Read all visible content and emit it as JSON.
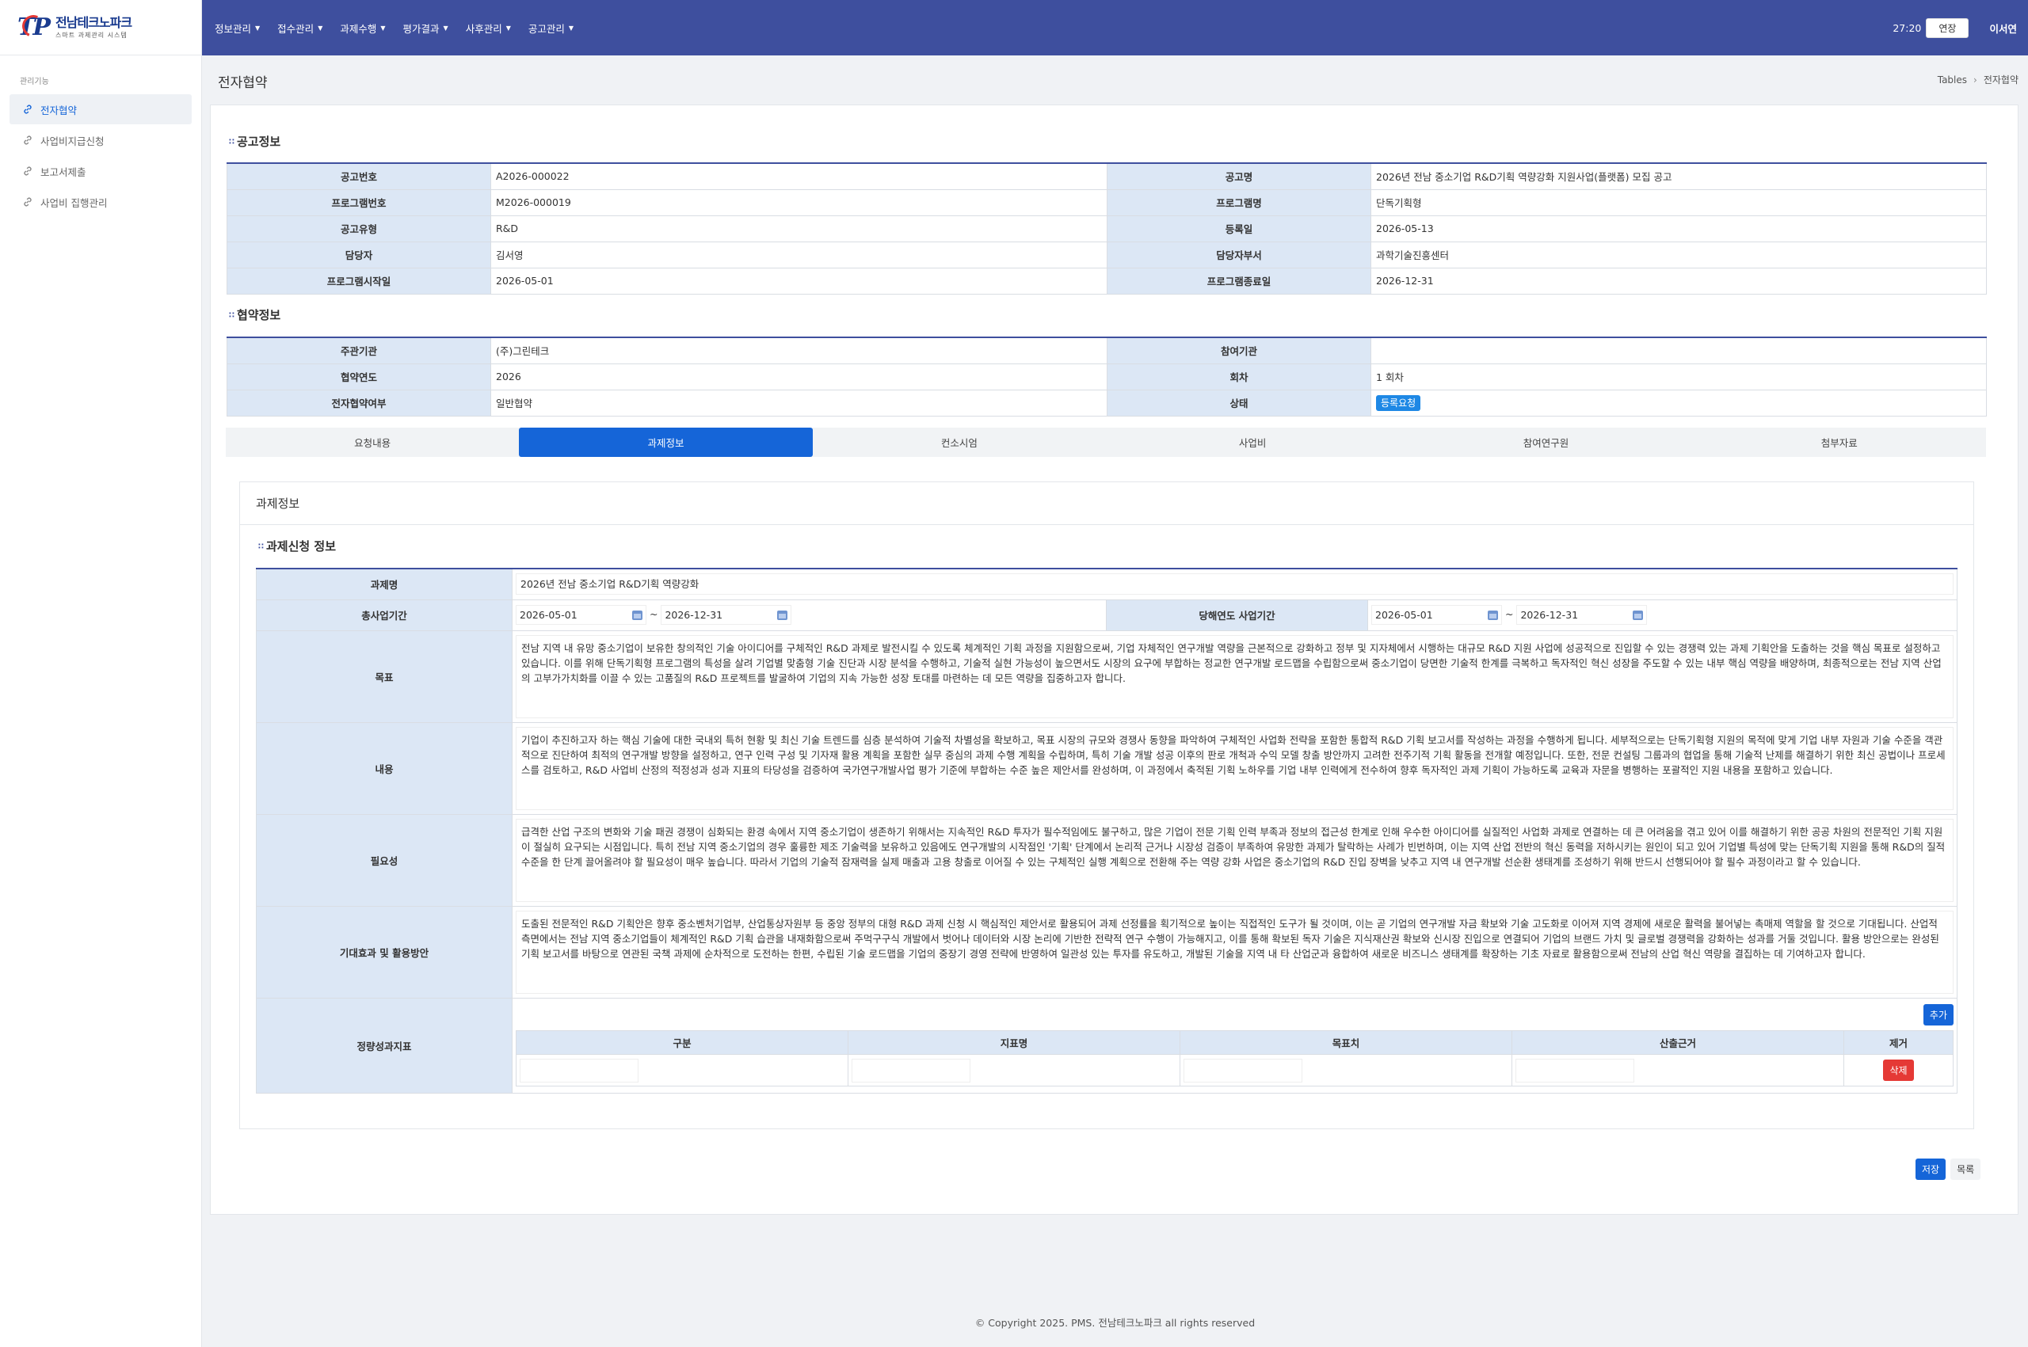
{
  "brand": {
    "name": "전남테크노파크",
    "subtitle": "스마트 과제관리 시스템",
    "mark": "TP"
  },
  "nav": [
    "정보관리",
    "접수관리",
    "과제수행",
    "평가결과",
    "사후관리",
    "공고관리"
  ],
  "header": {
    "timer": "27:20",
    "extend_label": "연장",
    "user": "이서연"
  },
  "sidebar": {
    "title": "관리기능",
    "items": [
      "전자협약",
      "사업비지급신청",
      "보고서제출",
      "사업비 집행관리"
    ]
  },
  "page": {
    "title": "전자협약",
    "breadcrumb": [
      "Tables",
      "전자협약"
    ]
  },
  "notice": {
    "title": "공고정보",
    "rows": [
      [
        "공고번호",
        "A2026-000022",
        "공고명",
        "2026년 전남 중소기업 R&D기획 역량강화 지원사업(플랫폼) 모집 공고"
      ],
      [
        "프로그램번호",
        "M2026-000019",
        "프로그램명",
        "단독기획형"
      ],
      [
        "공고유형",
        "R&D",
        "등록일",
        "2026-05-13"
      ],
      [
        "담당자",
        "김서영",
        "담당자부서",
        "과학기술진흥센터"
      ],
      [
        "프로그램시작일",
        "2026-05-01",
        "프로그램종료일",
        "2026-12-31"
      ]
    ]
  },
  "agreement": {
    "title": "협약정보",
    "rows": [
      [
        "주관기관",
        "(주)그린테크",
        "참여기관",
        ""
      ],
      [
        "협약연도",
        "2026",
        "회차",
        "1 회차"
      ],
      [
        "전자협약여부",
        "일반협약",
        "상태",
        "등록요청"
      ]
    ]
  },
  "tabs": [
    "요청내용",
    "과제정보",
    "컨소시엄",
    "사업비",
    "참여연구원",
    "첨부자료"
  ],
  "panel": {
    "heading": "과제정보",
    "section_title": "과제신청 정보"
  },
  "project": {
    "name_label": "과제명",
    "name": "2026년 전남 중소기업 R&D기획 역량강화",
    "period_label": "총사업기간",
    "period_start": "2026-05-01",
    "period_end": "2026-12-31",
    "year_label": "당해연도 사업기간",
    "year_start": "2026-05-01",
    "year_end": "2026-12-31",
    "tilde": "~",
    "goal_label": "목표",
    "goal": "전남 지역 내 유망 중소기업이 보유한 창의적인 기술 아이디어를 구체적인 R&D 과제로 발전시킬 수 있도록 체계적인 기획 과정을 지원함으로써, 기업 자체적인 연구개발 역량을 근본적으로 강화하고 정부 및 지자체에서 시행하는 대규모 R&D 지원 사업에 성공적으로 진입할 수 있는 경쟁력 있는 과제 기획안을 도출하는 것을 핵심 목표로 설정하고 있습니다. 이를 위해 단독기획형 프로그램의 특성을 살려 기업별 맞춤형 기술 진단과 시장 분석을 수행하고, 기술적 실현 가능성이 높으면서도 시장의 요구에 부합하는 정교한 연구개발 로드맵을 수립함으로써 중소기업이 당면한 기술적 한계를 극복하고 독자적인 혁신 성장을 주도할 수 있는 내부 핵심 역량을 배양하며, 최종적으로는 전남 지역 산업의 고부가가치화를 이끌 수 있는 고품질의 R&D 프로젝트를 발굴하여 기업의 지속 가능한 성장 토대를 마련하는 데 모든 역량을 집중하고자 합니다.",
    "content_label": "내용",
    "content": "기업이 추진하고자 하는 핵심 기술에 대한 국내외 특허 현황 및 최신 기술 트렌드를 심층 분석하여 기술적 차별성을 확보하고, 목표 시장의 규모와 경쟁사 동향을 파악하여 구체적인 사업화 전략을 포함한 통합적 R&D 기획 보고서를 작성하는 과정을 수행하게 됩니다. 세부적으로는 단독기획형 지원의 목적에 맞게 기업 내부 자원과 기술 수준을 객관적으로 진단하여 최적의 연구개발 방향을 설정하고, 연구 인력 구성 및 기자재 활용 계획을 포함한 실무 중심의 과제 수행 계획을 수립하며, 특히 기술 개발 성공 이후의 판로 개척과 수익 모델 창출 방안까지 고려한 전주기적 기획 활동을 전개할 예정입니다. 또한, 전문 컨설팅 그룹과의 협업을 통해 기술적 난제를 해결하기 위한 최신 공법이나 프로세스를 검토하고, R&D 사업비 산정의 적정성과 성과 지표의 타당성을 검증하여 국가연구개발사업 평가 기준에 부합하는 수준 높은 제안서를 완성하며, 이 과정에서 축적된 기획 노하우를 기업 내부 인력에게 전수하여 향후 독자적인 과제 기획이 가능하도록 교육과 자문을 병행하는 포괄적인 지원 내용을 포함하고 있습니다.",
    "need_label": "필요성",
    "need": "급격한 산업 구조의 변화와 기술 패권 경쟁이 심화되는 환경 속에서 지역 중소기업이 생존하기 위해서는 지속적인 R&D 투자가 필수적임에도 불구하고, 많은 기업이 전문 기획 인력 부족과 정보의 접근성 한계로 인해 우수한 아이디어를 실질적인 사업화 과제로 연결하는 데 큰 어려움을 겪고 있어 이를 해결하기 위한 공공 차원의 전문적인 기획 지원이 절실히 요구되는 시점입니다. 특히 전남 지역 중소기업의 경우 훌륭한 제조 기술력을 보유하고 있음에도 연구개발의 시작점인 '기획' 단계에서 논리적 근거나 시장성 검증이 부족하여 유망한 과제가 탈락하는 사례가 빈번하며, 이는 지역 산업 전반의 혁신 동력을 저하시키는 원인이 되고 있어 기업별 특성에 맞는 단독기획 지원을 통해 R&D의 질적 수준을 한 단계 끌어올려야 할 필요성이 매우 높습니다. 따라서 기업의 기술적 잠재력을 실제 매출과 고용 창출로 이어질 수 있는 구체적인 실행 계획으로 전환해 주는 역량 강화 사업은 중소기업의 R&D 진입 장벽을 낮추고 지역 내 연구개발 선순환 생태계를 조성하기 위해 반드시 선행되어야 할 필수 과정이라고 할 수 있습니다.",
    "effect_label": "기대효과 및 활용방안",
    "effect": "도출된 전문적인 R&D 기획안은 향후 중소벤처기업부, 산업통상자원부 등 중앙 정부의 대형 R&D 과제 신청 시 핵심적인 제안서로 활용되어 과제 선정률을 획기적으로 높이는 직접적인 도구가 될 것이며, 이는 곧 기업의 연구개발 자금 확보와 기술 고도화로 이어져 지역 경제에 새로운 활력을 불어넣는 촉매제 역할을 할 것으로 기대됩니다. 산업적 측면에서는 전남 지역 중소기업들이 체계적인 R&D 기획 습관을 내재화함으로써 주먹구구식 개발에서 벗어나 데이터와 시장 논리에 기반한 전략적 연구 수행이 가능해지고, 이를 통해 확보된 독자 기술은 지식재산권 확보와 신시장 진입으로 연결되어 기업의 브랜드 가치 및 글로벌 경쟁력을 강화하는 성과를 거둘 것입니다. 활용 방안으로는 완성된 기획 보고서를 바탕으로 연관된 국책 과제에 순차적으로 도전하는 한편, 수립된 기술 로드맵을 기업의 중장기 경영 전략에 반영하여 일관성 있는 투자를 유도하고, 개발된 기술을 지역 내 타 산업군과 융합하여 새로운 비즈니스 생태계를 확장하는 기초 자료로 활용함으로써 전남의 산업 혁신 역량을 결집하는 데 기여하고자 합니다.",
    "perf_label": "정량성과지표",
    "perf_add": "추가",
    "perf_headers": [
      "구분",
      "지표명",
      "목표치",
      "산출근거",
      "제거"
    ],
    "perf_delete": "삭제"
  },
  "actions": {
    "save": "저장",
    "list": "목록"
  },
  "footer": "© Copyright 2025. PMS. 전남테크노파크 all rights reserved"
}
